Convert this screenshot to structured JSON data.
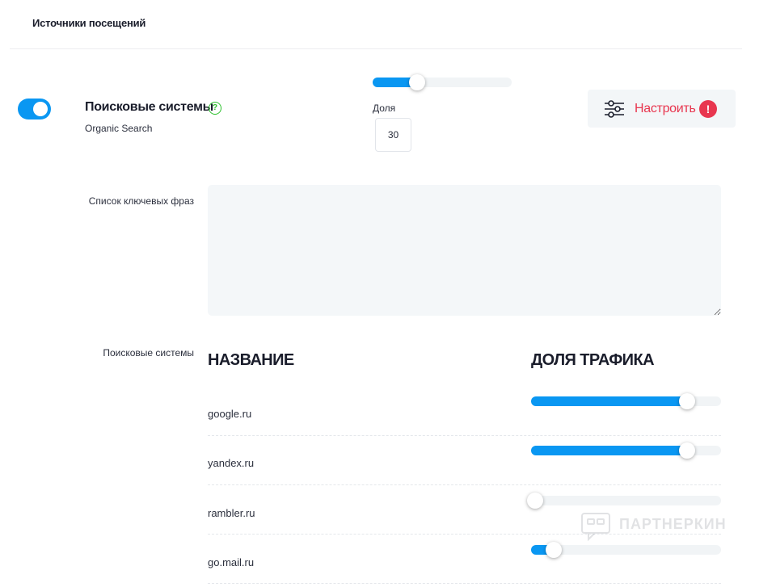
{
  "section": {
    "title": "Источники посещений"
  },
  "source": {
    "enabled": true,
    "name": "Поисковые системы",
    "subtitle": "Organic Search",
    "help_glyph": "?",
    "share_slider_fraction": 0.32,
    "share_label": "Доля",
    "share_value": "30"
  },
  "configure": {
    "label": "Настроить",
    "icon": "sliders-icon",
    "alert_glyph": "!"
  },
  "keywords": {
    "label": "Список ключевых фраз",
    "value": ""
  },
  "engines": {
    "label": "Поисковые системы",
    "col_name": "НАЗВАНИЕ",
    "col_share": "ДОЛЯ ТРАФИКА",
    "rows": [
      {
        "name": "google.ru",
        "share_fraction": 0.82
      },
      {
        "name": "yandex.ru",
        "share_fraction": 0.82
      },
      {
        "name": "rambler.ru",
        "share_fraction": 0.02
      },
      {
        "name": "go.mail.ru",
        "share_fraction": 0.12
      }
    ]
  },
  "watermark": {
    "text": "ПАРТНЕРКИН"
  },
  "colors": {
    "accent": "#0a97f2",
    "danger": "#e8364f",
    "success": "#2ec12e",
    "track": "#f1f4f6"
  }
}
